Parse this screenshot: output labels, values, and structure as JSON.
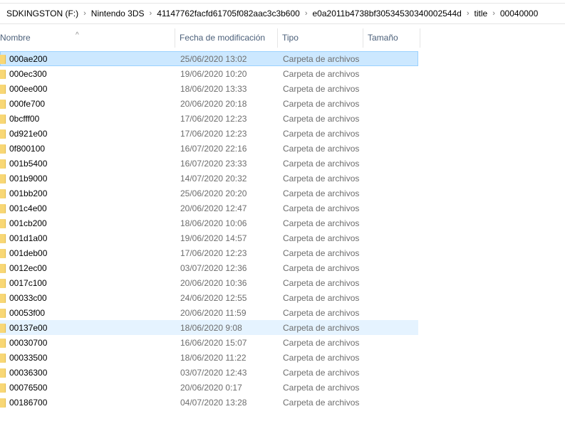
{
  "breadcrumb": [
    "SDKINGSTON (F:)",
    "Nintendo 3DS",
    "41147762facfd61705f082aac3c3b600",
    "e0a2011b4738bf30534530340002544d",
    "title",
    "00040000"
  ],
  "columns": {
    "name": "Nombre",
    "date": "Fecha de modificación",
    "type": "Tipo",
    "size": "Tamaño"
  },
  "selected_index": 0,
  "hover_index": 18,
  "files": [
    {
      "name": "000ae200",
      "date": "25/06/2020 13:02",
      "type": "Carpeta de archivos"
    },
    {
      "name": "000ec300",
      "date": "19/06/2020 10:20",
      "type": "Carpeta de archivos"
    },
    {
      "name": "000ee000",
      "date": "18/06/2020 13:33",
      "type": "Carpeta de archivos"
    },
    {
      "name": "000fe700",
      "date": "20/06/2020 20:18",
      "type": "Carpeta de archivos"
    },
    {
      "name": "0bcfff00",
      "date": "17/06/2020 12:23",
      "type": "Carpeta de archivos"
    },
    {
      "name": "0d921e00",
      "date": "17/06/2020 12:23",
      "type": "Carpeta de archivos"
    },
    {
      "name": "0f800100",
      "date": "16/07/2020 22:16",
      "type": "Carpeta de archivos"
    },
    {
      "name": "001b5400",
      "date": "16/07/2020 23:33",
      "type": "Carpeta de archivos"
    },
    {
      "name": "001b9000",
      "date": "14/07/2020 20:32",
      "type": "Carpeta de archivos"
    },
    {
      "name": "001bb200",
      "date": "25/06/2020 20:20",
      "type": "Carpeta de archivos"
    },
    {
      "name": "001c4e00",
      "date": "20/06/2020 12:47",
      "type": "Carpeta de archivos"
    },
    {
      "name": "001cb200",
      "date": "18/06/2020 10:06",
      "type": "Carpeta de archivos"
    },
    {
      "name": "001d1a00",
      "date": "19/06/2020 14:57",
      "type": "Carpeta de archivos"
    },
    {
      "name": "001deb00",
      "date": "17/06/2020 12:23",
      "type": "Carpeta de archivos"
    },
    {
      "name": "0012ec00",
      "date": "03/07/2020 12:36",
      "type": "Carpeta de archivos"
    },
    {
      "name": "0017c100",
      "date": "20/06/2020 10:36",
      "type": "Carpeta de archivos"
    },
    {
      "name": "00033c00",
      "date": "24/06/2020 12:55",
      "type": "Carpeta de archivos"
    },
    {
      "name": "00053f00",
      "date": "20/06/2020 11:59",
      "type": "Carpeta de archivos"
    },
    {
      "name": "00137e00",
      "date": "18/06/2020 9:08",
      "type": "Carpeta de archivos"
    },
    {
      "name": "00030700",
      "date": "16/06/2020 15:07",
      "type": "Carpeta de archivos"
    },
    {
      "name": "00033500",
      "date": "18/06/2020 11:22",
      "type": "Carpeta de archivos"
    },
    {
      "name": "00036300",
      "date": "03/07/2020 12:43",
      "type": "Carpeta de archivos"
    },
    {
      "name": "00076500",
      "date": "20/06/2020 0:17",
      "type": "Carpeta de archivos"
    },
    {
      "name": "00186700",
      "date": "04/07/2020 13:28",
      "type": "Carpeta de archivos"
    }
  ]
}
